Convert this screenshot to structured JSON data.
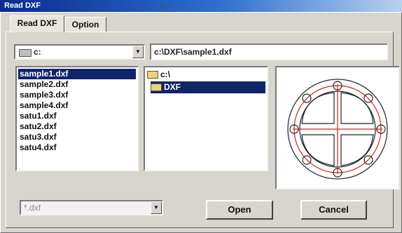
{
  "window": {
    "title": "Read DXF"
  },
  "tabs": [
    {
      "label": "Read DXF",
      "active": true
    },
    {
      "label": "Option",
      "active": false
    }
  ],
  "drive": {
    "value": "c:",
    "icon": "drive-icon"
  },
  "path": {
    "value": "c:\\DXF\\sample1.dxf"
  },
  "files": [
    {
      "name": "sample1.dxf",
      "selected": true
    },
    {
      "name": "sample2.dxf",
      "selected": false
    },
    {
      "name": "sample3.dxf",
      "selected": false
    },
    {
      "name": "sample4.dxf",
      "selected": false
    },
    {
      "name": "satu1.dxf",
      "selected": false
    },
    {
      "name": "satu2.dxf",
      "selected": false
    },
    {
      "name": "satu3.dxf",
      "selected": false
    },
    {
      "name": "satu4.dxf",
      "selected": false
    }
  ],
  "folders": [
    {
      "name": "c:\\",
      "icon": "open-folder-icon",
      "selected": false
    },
    {
      "name": "DXF",
      "icon": "open-folder-icon",
      "selected": true
    }
  ],
  "filter": {
    "value": "*.dxf"
  },
  "buttons": {
    "open": "Open",
    "cancel": "Cancel"
  },
  "colors": {
    "selection": "#10246a",
    "preview_red": "#d02020",
    "titlebar": "#0a2a8f"
  }
}
